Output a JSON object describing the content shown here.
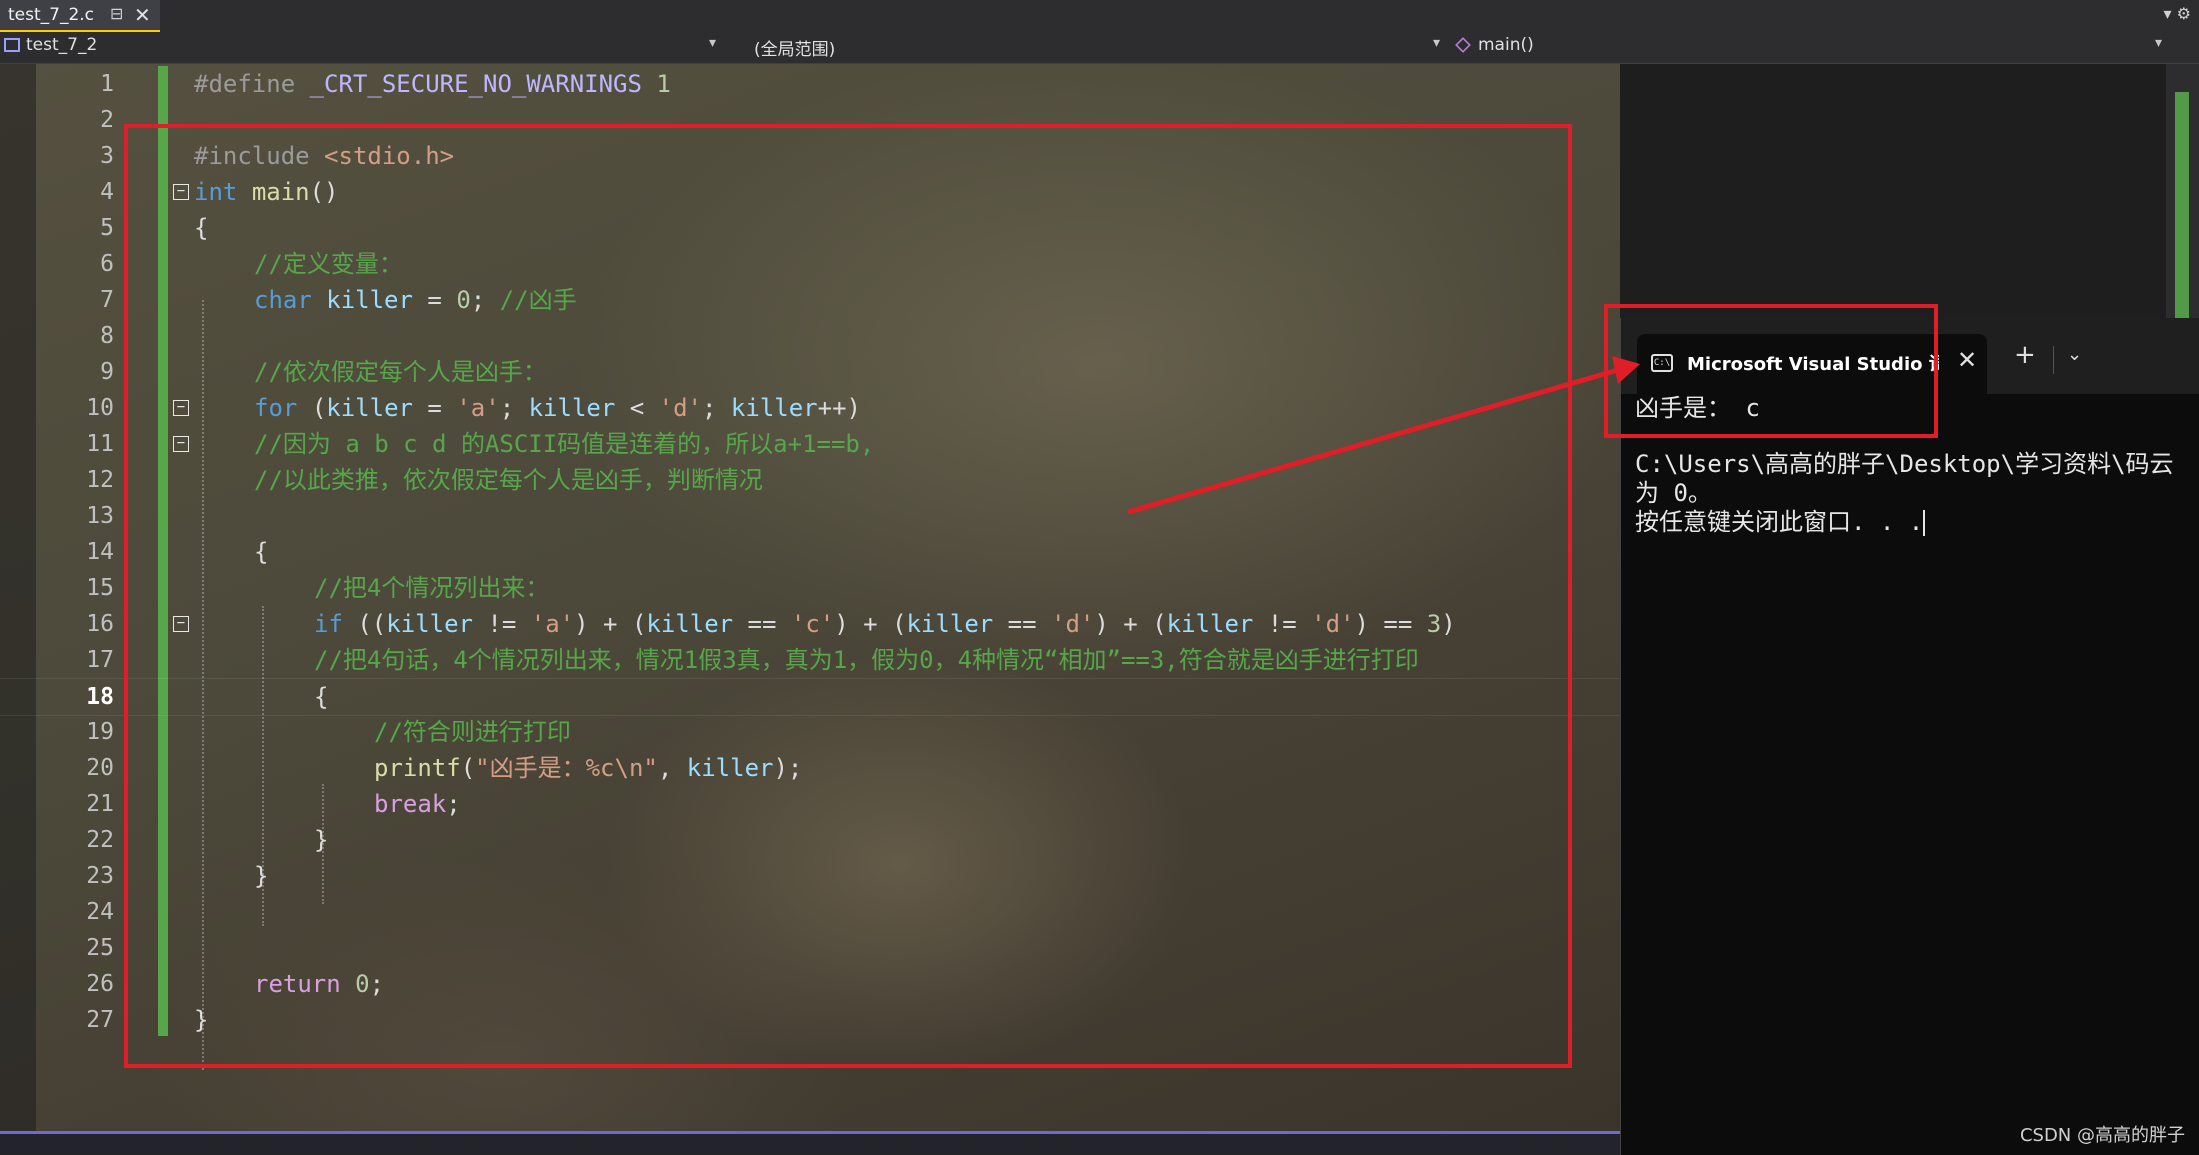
{
  "tab": {
    "label": "test_7_2.c",
    "pin_glyph": "⊟",
    "close_glyph": "✕"
  },
  "strip_right": "▾ ⚙",
  "navbar": {
    "project": "test_7_2",
    "scope": "(全局范围)",
    "member": "main()"
  },
  "editor": {
    "current_line": 18,
    "line_numbers": [
      "1",
      "2",
      "3",
      "4",
      "5",
      "6",
      "7",
      "8",
      "9",
      "10",
      "11",
      "12",
      "13",
      "14",
      "15",
      "16",
      "17",
      "18",
      "19",
      "20",
      "21",
      "22",
      "23",
      "24",
      "25",
      "26",
      "27"
    ],
    "code": {
      "l1_pp": "#define",
      "l1_macro": "_CRT_SECURE_NO_WARNINGS",
      "l1_num": "1",
      "l3_pp": "#include",
      "l3_hdr": "<stdio.h>",
      "l4_kw": "int",
      "l4_fn": "main",
      "l4_paren": "()",
      "l5": "{",
      "l6": "//定义变量：",
      "l7_kw": "char",
      "l7_var": "killer",
      "l7_eq": "=",
      "l7_num": "0",
      "l7_semi": ";",
      "l7_cm": "//凶手",
      "l9": "//依次假定每个人是凶手：",
      "l10_kw": "for",
      "l10_a": "(",
      "l10_v1": "killer",
      "l10_b": "=",
      "l10_s1": "'a'",
      "l10_c": ";",
      "l10_v2": "killer",
      "l10_d": "<",
      "l10_s2": "'d'",
      "l10_e": ";",
      "l10_v3": "killer",
      "l10_f": "++)",
      "l11": "//因为 a b c d 的ASCII码值是连着的，所以a+1==b,",
      "l12": "//以此类推，依次假定每个人是凶手，判断情况",
      "l14": "{",
      "l15": "//把4个情况列出来：",
      "l16_kw": "if",
      "l16_a": "((",
      "l16_v1": "killer",
      "l16_b": "!=",
      "l16_s1": "'a'",
      "l16_c": ") + (",
      "l16_v2": "killer",
      "l16_d": "==",
      "l16_s2": "'c'",
      "l16_e": ") + (",
      "l16_v3": "killer",
      "l16_f": "==",
      "l16_s3": "'d'",
      "l16_g": ") + (",
      "l16_v4": "killer",
      "l16_h": "!=",
      "l16_s4": "'d'",
      "l16_i": ") ==",
      "l16_n": "3",
      "l16_j": ")",
      "l17": "//把4句话，4个情况列出来，情况1假3真，真为1，假为0，4种情况“相加”==3,符合就是凶手进行打印",
      "l18": "{",
      "l19": "//符合则进行打印",
      "l20_fn": "printf",
      "l20_a": "(",
      "l20_s": "\"凶手是：%c\\n\"",
      "l20_b": ",",
      "l20_v": "killer",
      "l20_c": ");",
      "l21_kw": "break",
      "l21_semi": ";",
      "l22": "}",
      "l23": "}",
      "l26_kw": "return",
      "l26_num": "0",
      "l26_semi": ";",
      "l27": "}"
    }
  },
  "terminal": {
    "tab_title": "Microsoft Visual Studio 调试控制台",
    "icon_text": "C:\\",
    "close_glyph": "✕",
    "plus_glyph": "+",
    "dropdown_glyph": "⌄",
    "lines": [
      "凶手是： c",
      "",
      "C:\\Users\\高高的胖子\\Desktop\\学习资料\\码云",
      "为 0。",
      "按任意键关闭此窗口. . ."
    ]
  },
  "watermark": "CSDN @高高的胖子",
  "colors": {
    "annotation_red": "#e01e27",
    "change_bar_green": "#57a64a",
    "keyword": "#569cd6",
    "comment": "#57a64a",
    "string": "#d69d85"
  }
}
